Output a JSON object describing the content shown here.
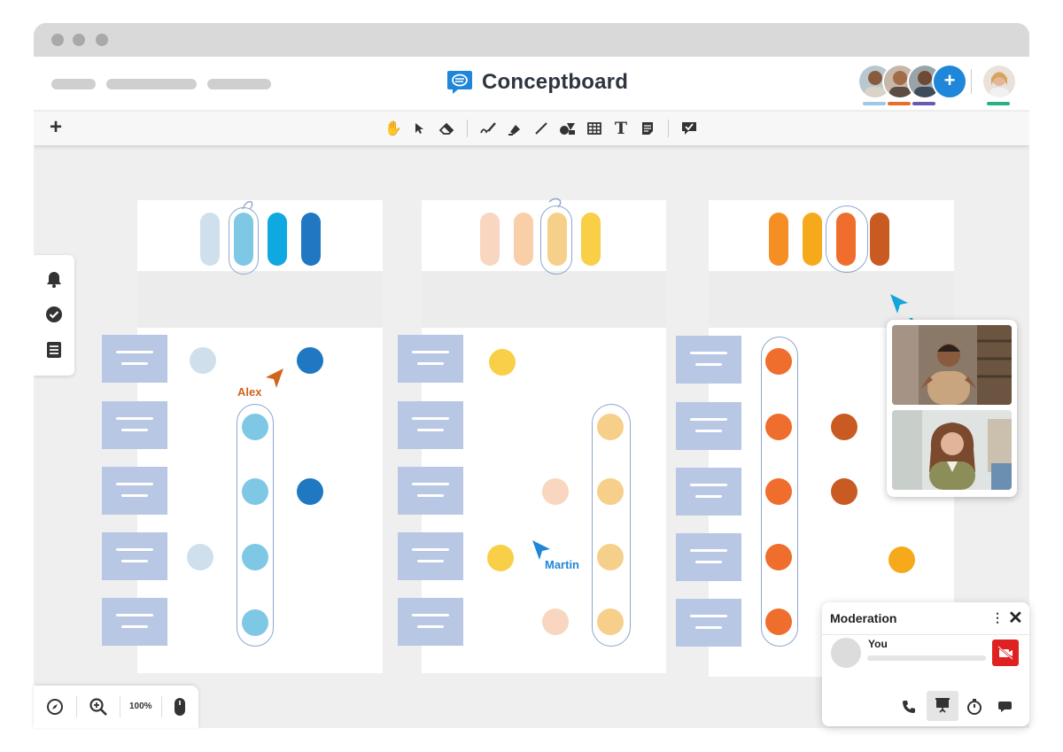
{
  "app": {
    "name": "Conceptboard"
  },
  "collaborators": {
    "add_label": "+",
    "avatar_colors": [
      "#9fc8e8",
      "#e76f2a",
      "#6a5ab5",
      "#2bb07f"
    ]
  },
  "toolbar": {
    "add_label": "+",
    "tools": [
      "hand-tool",
      "select-tool",
      "eraser-tool",
      "pen-tool",
      "highlighter-tool",
      "line-tool",
      "shapes-tool",
      "table-tool",
      "text-tool",
      "sticky-note-tool",
      "comment-tool"
    ]
  },
  "board": {
    "column_colors": {
      "blue": [
        "#cfe0ec",
        "#7ec8e6",
        "#0fa8e0",
        "#1f78c1"
      ],
      "yellow": [
        "#f8d6c0",
        "#f8cfa8",
        "#f6cf8a",
        "#f8cf46"
      ],
      "orange": [
        "#f58f24",
        "#f7a91c",
        "#ef6e2e",
        "#c95a22"
      ]
    }
  },
  "cursors": {
    "alex": {
      "label": "Alex",
      "color": "#d0641d"
    },
    "martin": {
      "label": "Martin",
      "color": "#1f86d9"
    },
    "joy": {
      "label": "Joy",
      "color": "#12a7d8"
    }
  },
  "zoom": {
    "level": "100%"
  },
  "moderation": {
    "title": "Moderation",
    "kebab": "⋮",
    "close": "✕",
    "participant": "You"
  }
}
